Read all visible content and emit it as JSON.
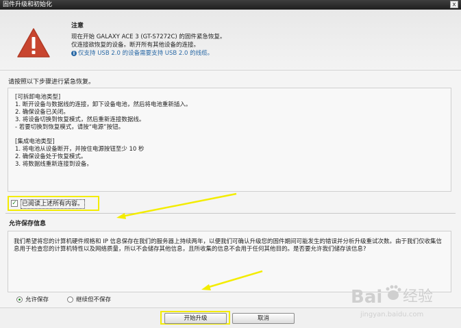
{
  "window": {
    "title": "固件升级和初始化",
    "close_label": "x"
  },
  "notice": {
    "icon": "warning-triangle-icon",
    "heading": "注意",
    "line1": "现在开始 GALAXY ACE 3 (GT-S7272C) 的固件紧急恢复。",
    "line2": "仅连接欲恢复的设备。断开所有其他设备的连接。",
    "info": "仅支持 USB 2.0 的设备需要支持 USB 2.0 的线缆。",
    "info_icon": "info-icon"
  },
  "instructions": {
    "heading": "请按照以下步骤进行紧急恢复。",
    "removable": [
      "[可拆卸电池类型]",
      "1. 断开设备与数据线的连接，卸下设备电池，然后将电池重新插入。",
      "2. 确保设备已关闭。",
      "3. 将设备切换到恢复模式，然后重新连接数据线。",
      "- 若要切换到恢复模式，请按“电源”按钮。"
    ],
    "integrated": [
      "[集成电池类型]",
      "1. 将电池从设备断开，并按住电源按钮至少 10 秒",
      "2. 确保设备处于恢复模式。",
      "3. 将数据线重新连接到设备。"
    ]
  },
  "acknowledge": {
    "label": "已阅读上述所有内容。",
    "checked": true
  },
  "permission": {
    "heading": "允许保存信息",
    "text": "我们希望将您的计算机硬件规格和 IP 信息保存在我们的服务器上持续两年，以便我们可确认升级您的固件期间可能发生的错误并分析升级重试次数。由于我们仅收集信息用于检查您的计算机特性以及网络质量，所以不会储存其他信息，且所收集的信息不会用于任何其他目的。是否要允许我们储存该信息?",
    "options": [
      {
        "label": "允许保存",
        "selected": true
      },
      {
        "label": "继续但不保存",
        "selected": false
      }
    ]
  },
  "buttons": {
    "start": "开始升级",
    "cancel": "取消"
  },
  "watermark": {
    "brand": "Bai",
    "brand2": "经验",
    "url": "jingyan.baidu.com"
  },
  "colors": {
    "highlight": "#f3ec00",
    "warning_red": "#c8452f",
    "link_blue": "#2b6aa6",
    "check_green": "#2a8a2a"
  }
}
